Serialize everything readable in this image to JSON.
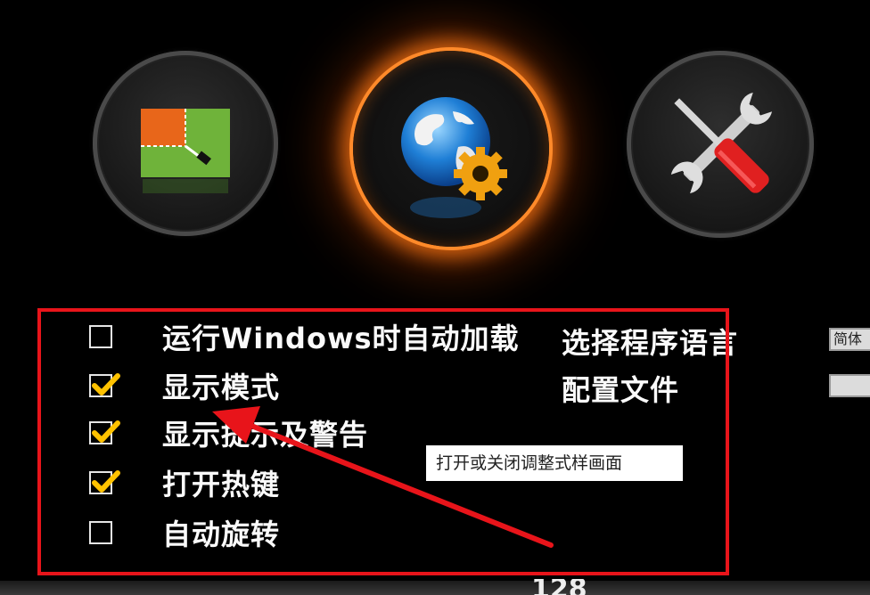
{
  "toolbar": {
    "buttons": [
      {
        "id": "display",
        "icon": "display-layout-icon"
      },
      {
        "id": "network",
        "icon": "globe-gear-icon",
        "active": true
      },
      {
        "id": "options",
        "icon": "wrench-screwdriver-icon"
      }
    ],
    "active_glow_color": "#ff8a2a"
  },
  "options": {
    "items": [
      {
        "label": "运行Windows时自动加载",
        "checked": false
      },
      {
        "label": "显示模式",
        "checked": true
      },
      {
        "label": "显示提示及警告",
        "checked": true
      },
      {
        "label": "打开热键",
        "checked": true
      },
      {
        "label": "自动旋转",
        "checked": false
      }
    ],
    "links": {
      "language": "选择程序语言",
      "profile": "配置文件"
    },
    "language_select_value": "简体"
  },
  "annotation": {
    "tooltip": "打开或关闭调整式样画面",
    "frame_color": "#e8141a",
    "arrow_color": "#e8141a"
  },
  "footer": {
    "partial_text": "128"
  }
}
